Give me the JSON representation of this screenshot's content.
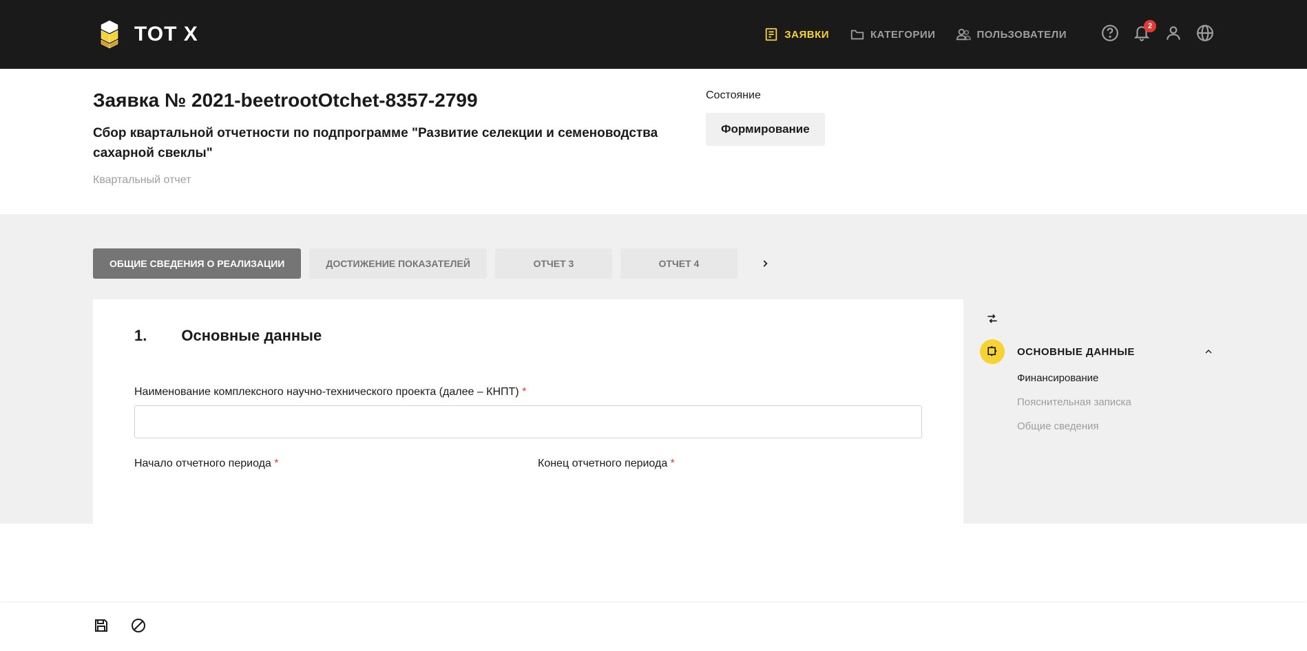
{
  "header": {
    "logo_text": "TOT X",
    "nav": [
      {
        "label": "ЗАЯВКИ",
        "active": true
      },
      {
        "label": "КАТЕГОРИИ",
        "active": false
      },
      {
        "label": "ПОЛЬЗОВАТЕЛИ",
        "active": false
      }
    ],
    "badge_count": "2"
  },
  "title": {
    "main": "Заявка № 2021-beetrootOtchet-8357-2799",
    "subtitle": "Сбор квартальной отчетности по подпрограмме \"Развитие селекции и семеноводства сахарной свеклы\"",
    "meta": "Квартальный отчет",
    "status_label": "Состояние",
    "status_value": "Формирование"
  },
  "tabs": [
    "ОБЩИЕ СВЕДЕНИЯ О РЕАЛИЗАЦИИ",
    "ДОСТИЖЕНИЕ ПОКАЗАТЕЛЕЙ",
    "ОТЧЕТ 3",
    "ОТЧЕТ 4"
  ],
  "section": {
    "num": "1.",
    "title": "Основные данные"
  },
  "form": {
    "field1_label": "Наименование комплексного научно-технического проекта (далее – КНПТ)",
    "field2_label": "Начало отчетного периода",
    "field3_label": "Конец отчетного периода"
  },
  "sidenav": {
    "main_label": "ОСНОВНЫЕ ДАННЫЕ",
    "items": [
      "Финансирование",
      "Пояснительная записка",
      "Общие сведения"
    ]
  }
}
